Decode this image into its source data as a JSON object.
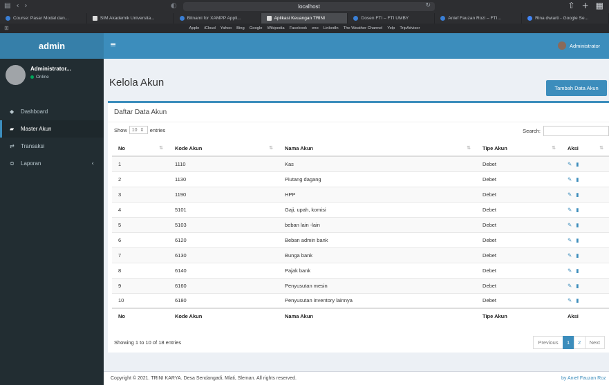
{
  "browser": {
    "url": "localhost",
    "tabs": [
      {
        "label": "Course: Pasar Modal dan..."
      },
      {
        "label": "SIM Akademik Universita..."
      },
      {
        "label": "Bitnami for XAMPP Appli..."
      },
      {
        "label": "Aplikasi Keuangan TRINI"
      },
      {
        "label": "Dosen FTI – FTI UMBY"
      },
      {
        "label": "Anief Fauzan Rozi – FTI..."
      },
      {
        "label": "Rina dwiarti - Google Se..."
      }
    ],
    "bookmarks": [
      "Apple",
      "iCloud",
      "Yahoo",
      "Bing",
      "Google",
      "Wikipedia",
      "Facebook",
      "eno",
      "LinkedIn",
      "The Weather Channel",
      "Yelp",
      "TripAdvisor"
    ]
  },
  "header": {
    "logo": "admin",
    "user": "Administrator"
  },
  "sidebar": {
    "user_name": "Administrator...",
    "status": "Online",
    "items": [
      {
        "label": "Dashboard"
      },
      {
        "label": "Master Akun"
      },
      {
        "label": "Transaksi"
      },
      {
        "label": "Laporan"
      }
    ]
  },
  "page": {
    "title": "Kelola Akun",
    "add_button": "Tambah Data Akun"
  },
  "box": {
    "title": "Daftar Data Akun",
    "show_label": "Show",
    "entries_label": "entries",
    "page_length": "10",
    "search_label": "Search:",
    "columns": [
      "No",
      "Kode Akun",
      "Nama Akun",
      "Tipe Akun",
      "Aksi"
    ],
    "rows": [
      {
        "no": "1",
        "kode": "1110",
        "nama": "Kas",
        "tipe": "Debet"
      },
      {
        "no": "2",
        "kode": "1130",
        "nama": "Piutang dagang",
        "tipe": "Debet"
      },
      {
        "no": "3",
        "kode": "1190",
        "nama": "HPP",
        "tipe": "Debet"
      },
      {
        "no": "4",
        "kode": "5101",
        "nama": "Gaji, upah, komisi",
        "tipe": "Debet"
      },
      {
        "no": "5",
        "kode": "5103",
        "nama": "beban lain -lain",
        "tipe": "Debet"
      },
      {
        "no": "6",
        "kode": "6120",
        "nama": "Beban admin bank",
        "tipe": "Debet"
      },
      {
        "no": "7",
        "kode": "6130",
        "nama": "Bunga bank",
        "tipe": "Debet"
      },
      {
        "no": "8",
        "kode": "6140",
        "nama": "Pajak bank",
        "tipe": "Debet"
      },
      {
        "no": "9",
        "kode": "6160",
        "nama": "Penyusutan mesin",
        "tipe": "Debet"
      },
      {
        "no": "10",
        "kode": "6180",
        "nama": "Penyusutan inventory lainnya",
        "tipe": "Debet"
      }
    ],
    "info": "Showing 1 to 10 of 18 entries",
    "pagination": {
      "previous": "Previous",
      "pages": [
        "1",
        "2"
      ],
      "next": "Next"
    }
  },
  "footer": {
    "copyright": "Copyright © 2021. TRINI KARYA. Desa Sendangadi, Mlati, Sleman. All rights reserved.",
    "byline": "by Anief Fauzan Rozi"
  },
  "colors": {
    "primary": "#3c8dbc",
    "sidebar": "#222d32",
    "online": "#00a65a"
  }
}
